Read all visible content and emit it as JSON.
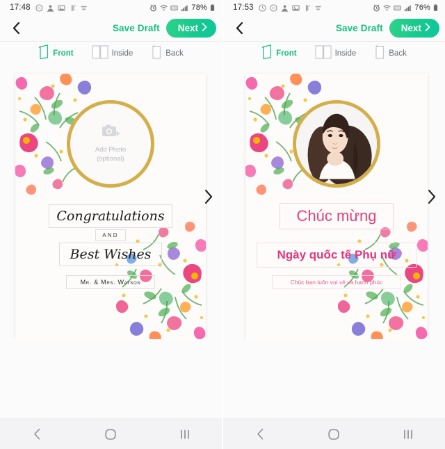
{
  "phones": [
    {
      "id": "left",
      "status": {
        "time": "17:48",
        "battery": "78%",
        "icons": [
          "do-not-disturb-icon",
          "contacts-icon",
          "gallery-icon",
          "bluetooth-share-icon",
          "menu-lines-icon"
        ],
        "right_icons": [
          "alarm-icon",
          "wifi-icon",
          "mobile-data-icon",
          "signal-icon"
        ]
      },
      "topnav": {
        "back_icon": "chevron-left-icon",
        "save_label": "Save Draft",
        "next_label": "Next",
        "next_icon": "chevron-right-icon",
        "accent": "#15c07a"
      },
      "tabs": [
        {
          "label": "Front",
          "icon": "card-front-icon",
          "active": true
        },
        {
          "label": "Inside",
          "icon": "card-inside-icon",
          "active": false
        },
        {
          "label": "Back",
          "icon": "card-back-icon",
          "active": false
        }
      ],
      "card": {
        "photo": {
          "state": "empty",
          "icon": "add-photo-camera-icon",
          "line1": "Add Photo",
          "line2": "(optional)",
          "ring_color": "#d3ae4a"
        },
        "texts": [
          {
            "name": "headline",
            "value": "Congratulations"
          },
          {
            "name": "connector",
            "value": "AND"
          },
          {
            "name": "subheadline",
            "value": "Best Wishes"
          },
          {
            "name": "signature",
            "value": "Mr. & Mrs. Watson"
          }
        ]
      },
      "carousel_next_icon": "chevron-right-icon"
    },
    {
      "id": "right",
      "status": {
        "time": "17:53",
        "battery": "76%",
        "icons": [
          "alarm-snooze-icon",
          "do-not-disturb-icon",
          "contacts-icon",
          "gallery-icon",
          "bluetooth-share-icon",
          "menu-lines-icon"
        ],
        "right_icons": [
          "alarm-icon",
          "wifi-icon",
          "mobile-data-icon",
          "signal-icon"
        ]
      },
      "topnav": {
        "back_icon": "chevron-left-icon",
        "save_label": "Save Draft",
        "next_label": "Next",
        "next_icon": "chevron-right-icon",
        "accent": "#15c07a"
      },
      "tabs": [
        {
          "label": "Front",
          "icon": "card-front-icon",
          "active": true
        },
        {
          "label": "Inside",
          "icon": "card-inside-icon",
          "active": false
        },
        {
          "label": "Back",
          "icon": "card-back-icon",
          "active": false
        }
      ],
      "card": {
        "photo": {
          "state": "filled",
          "icon": "portrait-photo",
          "line1": "",
          "line2": "",
          "ring_color": "#d3ae4a"
        },
        "texts": [
          {
            "name": "headline",
            "value": "Chúc mừng"
          },
          {
            "name": "subheadline",
            "value": "Ngày quốc tế Phụ nữ"
          },
          {
            "name": "message",
            "value": "Chúc bạn luôn vui vẻ và hạnh phúc"
          }
        ]
      },
      "carousel_next_icon": "chevron-right-icon"
    }
  ],
  "bottom_nav": [
    {
      "name": "back",
      "icon": "android-back-icon"
    },
    {
      "name": "home",
      "icon": "android-home-icon"
    },
    {
      "name": "recents",
      "icon": "android-recents-icon"
    }
  ]
}
